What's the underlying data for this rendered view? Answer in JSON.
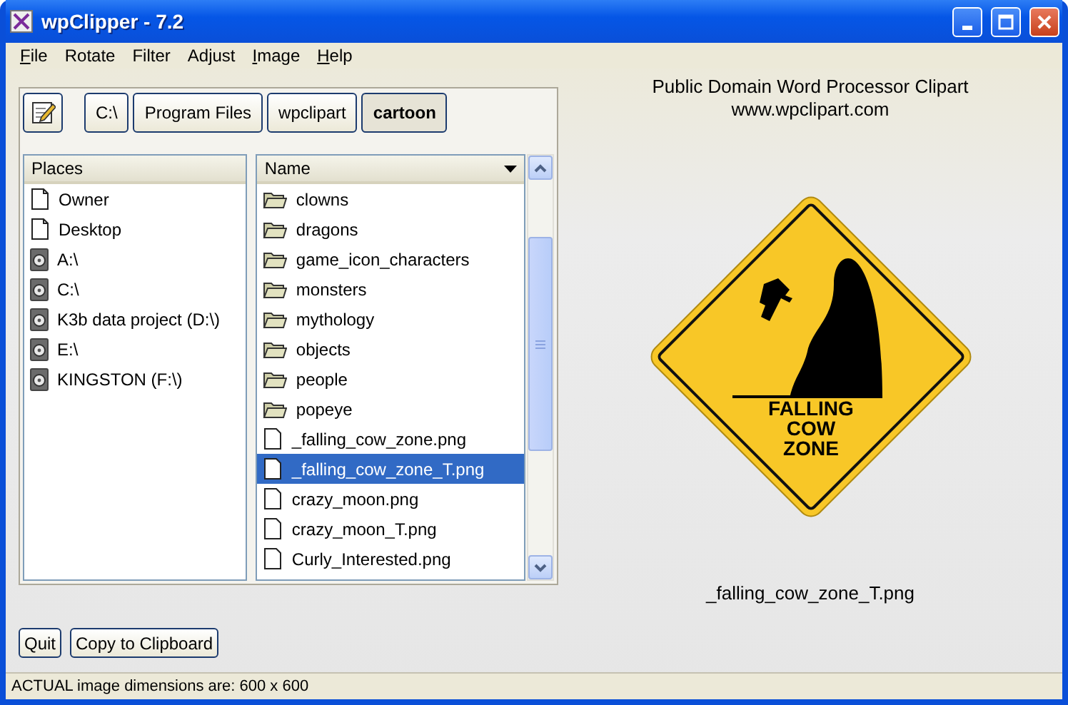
{
  "window": {
    "title": "wpClipper - 7.2"
  },
  "menu": [
    {
      "label": "File",
      "mnemonic": true
    },
    {
      "label": "Rotate",
      "mnemonic": false
    },
    {
      "label": "Filter",
      "mnemonic": false
    },
    {
      "label": "Adjust",
      "mnemonic": false
    },
    {
      "label": "Image",
      "mnemonic": true
    },
    {
      "label": "Help",
      "mnemonic": true
    }
  ],
  "path": [
    {
      "label": "C:\\",
      "selected": false
    },
    {
      "label": "Program Files",
      "selected": false
    },
    {
      "label": "wpclipart",
      "selected": false
    },
    {
      "label": "cartoon",
      "selected": true
    }
  ],
  "places": {
    "header": "Places",
    "items": [
      {
        "label": "Owner",
        "kind": "page"
      },
      {
        "label": "Desktop",
        "kind": "page"
      },
      {
        "label": "A:\\",
        "kind": "drive"
      },
      {
        "label": "C:\\",
        "kind": "drive"
      },
      {
        "label": "K3b data project (D:\\)",
        "kind": "drive"
      },
      {
        "label": "E:\\",
        "kind": "drive"
      },
      {
        "label": "KINGSTON (F:\\)",
        "kind": "drive"
      }
    ]
  },
  "files": {
    "header": "Name",
    "items": [
      {
        "label": "clowns",
        "kind": "folder",
        "selected": false
      },
      {
        "label": "dragons",
        "kind": "folder",
        "selected": false
      },
      {
        "label": "game_icon_characters",
        "kind": "folder",
        "selected": false
      },
      {
        "label": "monsters",
        "kind": "folder",
        "selected": false
      },
      {
        "label": "mythology",
        "kind": "folder",
        "selected": false
      },
      {
        "label": "objects",
        "kind": "folder",
        "selected": false
      },
      {
        "label": "people",
        "kind": "folder",
        "selected": false
      },
      {
        "label": "popeye",
        "kind": "folder",
        "selected": false
      },
      {
        "label": "_falling_cow_zone.png",
        "kind": "file",
        "selected": false
      },
      {
        "label": "_falling_cow_zone_T.png",
        "kind": "file",
        "selected": true
      },
      {
        "label": "crazy_moon.png",
        "kind": "file",
        "selected": false
      },
      {
        "label": "crazy_moon_T.png",
        "kind": "file",
        "selected": false
      },
      {
        "label": "Curly_Interested.png",
        "kind": "file",
        "selected": false
      }
    ]
  },
  "preview": {
    "heading": "Public Domain Word Processor Clipart",
    "site": "www.wpclipart.com",
    "sign_lines": [
      "FALLING",
      "COW",
      "ZONE"
    ],
    "filename": "_falling_cow_zone_T.png"
  },
  "buttons": [
    "Quit",
    "Copy to Clipboard"
  ],
  "status_bar": "ACTUAL image dimensions are: 600 x 600"
}
